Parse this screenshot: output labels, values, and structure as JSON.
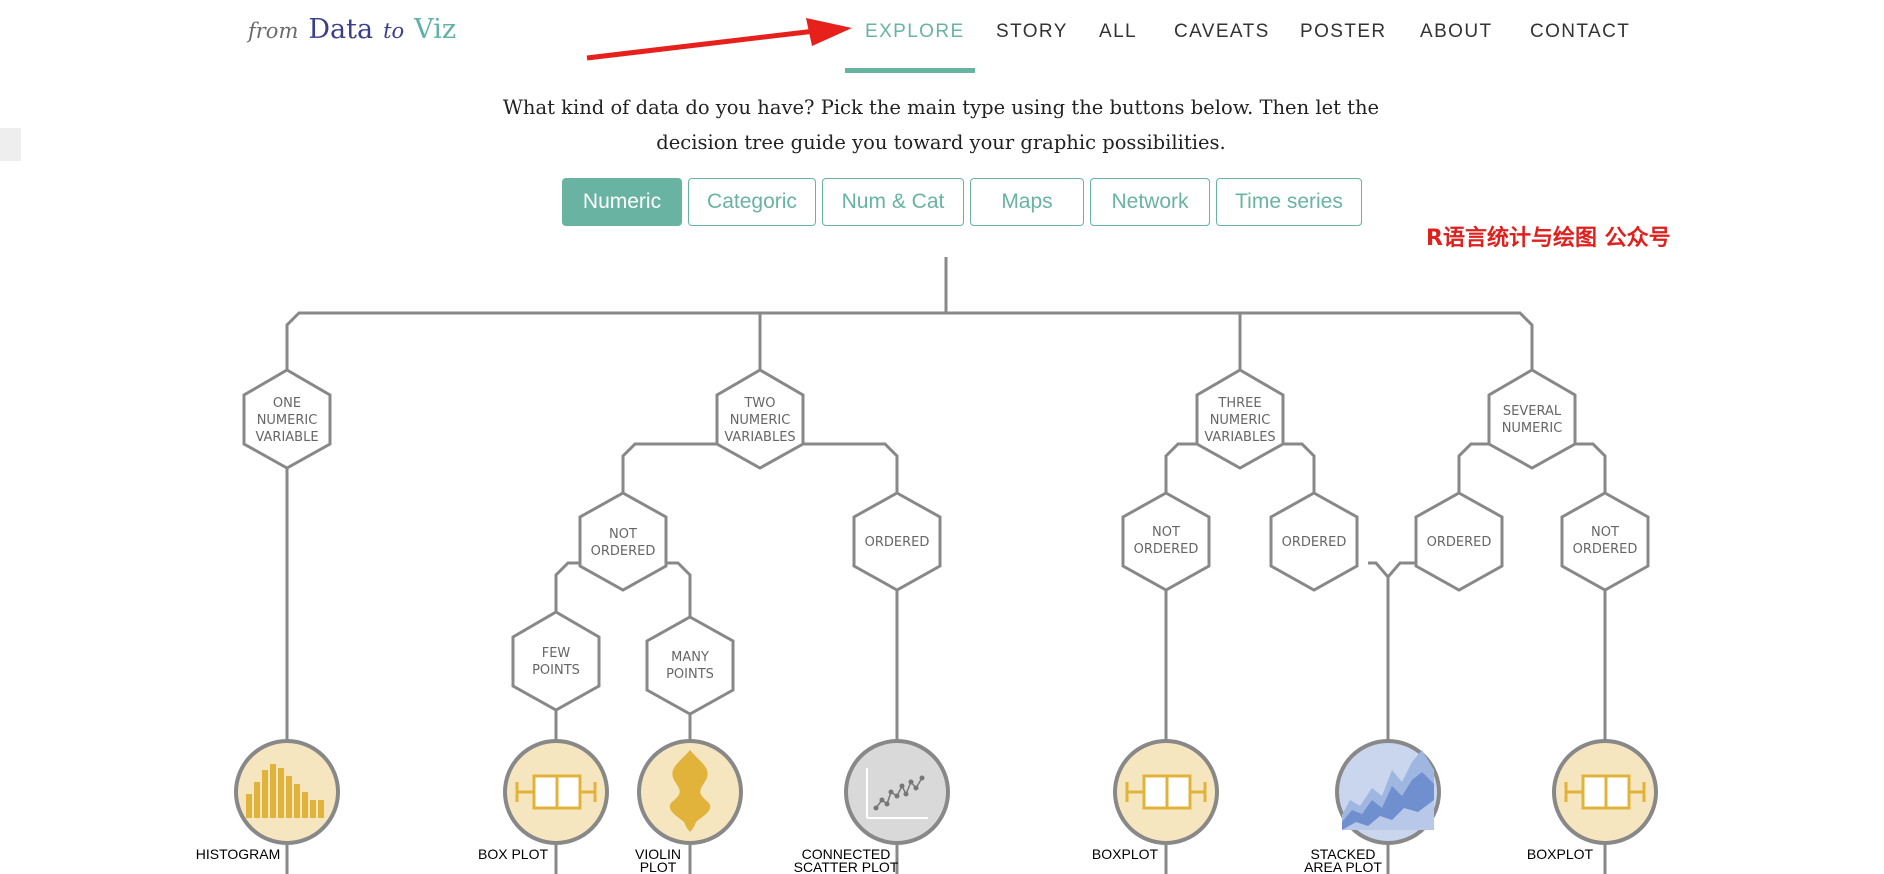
{
  "logo": {
    "word1": "from",
    "word2": "Data",
    "word3": "to",
    "word4": "Viz"
  },
  "nav": {
    "items": [
      "EXPLORE",
      "STORY",
      "ALL",
      "CAVEATS",
      "POSTER",
      "ABOUT",
      "CONTACT"
    ],
    "active": "EXPLORE"
  },
  "intro": {
    "line1": "What kind of data do you have? Pick the main type using the buttons below. Then let the",
    "line2": "decision tree guide you toward your graphic possibilities."
  },
  "types": [
    "Numeric",
    "Categoric",
    "Num & Cat",
    "Maps",
    "Network",
    "Time series"
  ],
  "active_type": "Numeric",
  "watermark": "R语言统计与绘图 公众号",
  "tree": {
    "branches": {
      "one": "ONE\nNUMERIC\nVARIABLE",
      "two": "TWO\nNUMERIC\nVARIABLES",
      "three": "THREE\nNUMERIC\nVARIABLES",
      "several": "SEVERAL\nNUMERIC"
    },
    "sub": {
      "two_not_ordered": "NOT\nORDERED",
      "two_ordered": "ORDERED",
      "few_points": "FEW\nPOINTS",
      "many_points": "MANY\nPOINTS",
      "three_not_ordered": "NOT\nORDERED",
      "three_ordered": "ORDERED",
      "several_ordered": "ORDERED",
      "several_not_ordered": "NOT\nORDERED"
    },
    "leaves": {
      "histogram": "HISTOGRAM",
      "box_plot": "BOX PLOT",
      "violin_plot": "VIOLIN\nPLOT",
      "connected_scatter": "CONNECTED\nSCATTER PLOT",
      "boxplot_three": "BOXPLOT",
      "stacked_area": "STACKED\nAREA PLOT",
      "boxplot_several": "BOXPLOT"
    }
  },
  "colors": {
    "accent": "#69b3a2",
    "tree_line": "#888888",
    "leaf_fill": "#f6e6c0",
    "leaf_icon": "#e2b33b",
    "arrow": "#e8201c",
    "watermark": "#e0201d"
  },
  "icons": [
    "red-arrow-icon",
    "histogram-icon",
    "boxplot-icon",
    "violin-icon",
    "scatter-icon",
    "stacked-area-icon"
  ]
}
